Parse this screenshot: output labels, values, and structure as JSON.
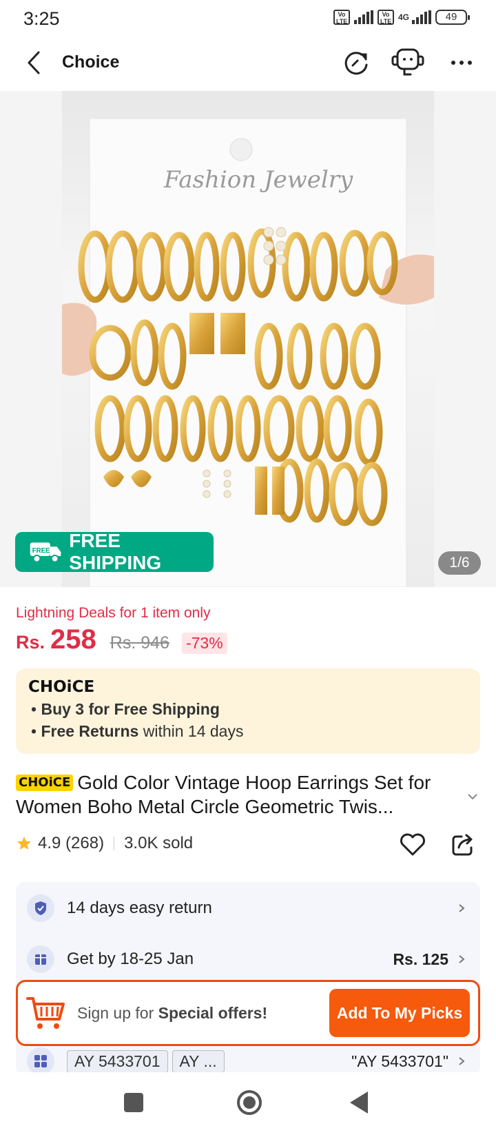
{
  "status_bar": {
    "time": "3:25",
    "network": "4G",
    "battery": "49"
  },
  "header": {
    "title": "Choice",
    "icons": [
      "back-arrow-icon",
      "refresh-icon",
      "support-agent-icon",
      "more-icon"
    ]
  },
  "gallery": {
    "brand_card_text": "Fashion Jewelry",
    "free_shipping_label": "FREE SHIPPING",
    "free_badge": "FREE",
    "counter": "1/6"
  },
  "pricing": {
    "deal_text": "Lightning Deals for 1 item only",
    "currency": "Rs.",
    "price": "258",
    "old_price": "Rs. 946",
    "discount": "-73%"
  },
  "choice_box": {
    "logo": "CHOiCE",
    "bullet1_bold": "Buy 3 for  Free Shipping",
    "bullet2_bold": "Free Returns",
    "bullet2_rest": " within 14 days"
  },
  "product": {
    "badge": "CHOiCE",
    "title": "Gold Color Vintage Hoop Earrings Set for Women Boho Metal Circle Geometric Twis...",
    "rating": "4.9",
    "reviews": "(268)",
    "sold": "3.0K sold"
  },
  "info_rows": {
    "returns": "14 days easy return",
    "delivery": "Get by 18-25 Jan",
    "delivery_price": "Rs. 125",
    "sku1": "AY 5433701",
    "sku2": "AY ...",
    "sku_selected": "\"AY 5433701\""
  },
  "promo": {
    "text_pre": "Sign up for ",
    "text_bold": "Special offers!",
    "button": "Add To My Picks"
  },
  "colors": {
    "accent": "#f55a0d",
    "price_red": "#e02d45",
    "free_green": "#00a884",
    "choice_yellow": "#fcd200"
  }
}
